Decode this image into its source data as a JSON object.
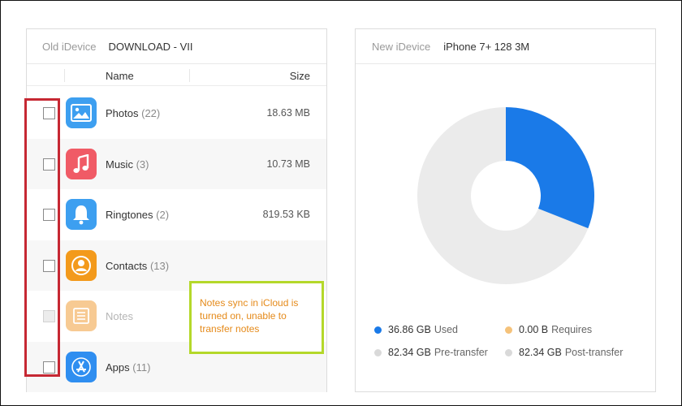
{
  "old_device": {
    "label": "Old iDevice",
    "name": "DOWNLOAD - VII",
    "columns": {
      "name": "Name",
      "size": "Size"
    },
    "items": [
      {
        "name": "Photos",
        "count": "(22)",
        "size": "18.63 MB",
        "icon": "photos-icon",
        "color": "#3d9ff0",
        "disabled": false
      },
      {
        "name": "Music",
        "count": "(3)",
        "size": "10.73 MB",
        "icon": "music-icon",
        "color": "#f05b66",
        "disabled": false
      },
      {
        "name": "Ringtones",
        "count": "(2)",
        "size": "819.53 KB",
        "icon": "bell-icon",
        "color": "#3d9ff0",
        "disabled": false
      },
      {
        "name": "Contacts",
        "count": "(13)",
        "size": "",
        "icon": "contacts-icon",
        "color": "#f39a1c",
        "disabled": false
      },
      {
        "name": "Notes",
        "count": "",
        "size": "",
        "icon": "notes-icon",
        "color": "#f2a03c",
        "disabled": true
      },
      {
        "name": "Apps",
        "count": "(11)",
        "size": "",
        "icon": "apps-icon",
        "color": "#2f8ef0",
        "disabled": false
      }
    ],
    "notes_warning": "Notes sync in iCloud is turned on, unable to transfer notes"
  },
  "new_device": {
    "label": "New iDevice",
    "name": "iPhone 7+ 128 3M",
    "usage": {
      "used_fraction": 0.31
    },
    "legend": [
      {
        "value": "36.86 GB",
        "label": "Used",
        "color": "#1a7ae8"
      },
      {
        "value": "0.00 B",
        "label": "Requires",
        "color": "#f5c27a"
      },
      {
        "value": "82.34 GB",
        "label": "Pre-transfer",
        "color": "#d9d9d9"
      },
      {
        "value": "82.34 GB",
        "label": "Post-transfer",
        "color": "#d9d9d9"
      }
    ]
  },
  "colors": {
    "used": "#1a7ae8",
    "free": "#ebebeb",
    "highlight_red": "#c62833",
    "highlight_green": "#b4d82a",
    "warning_text": "#e58a1a"
  }
}
